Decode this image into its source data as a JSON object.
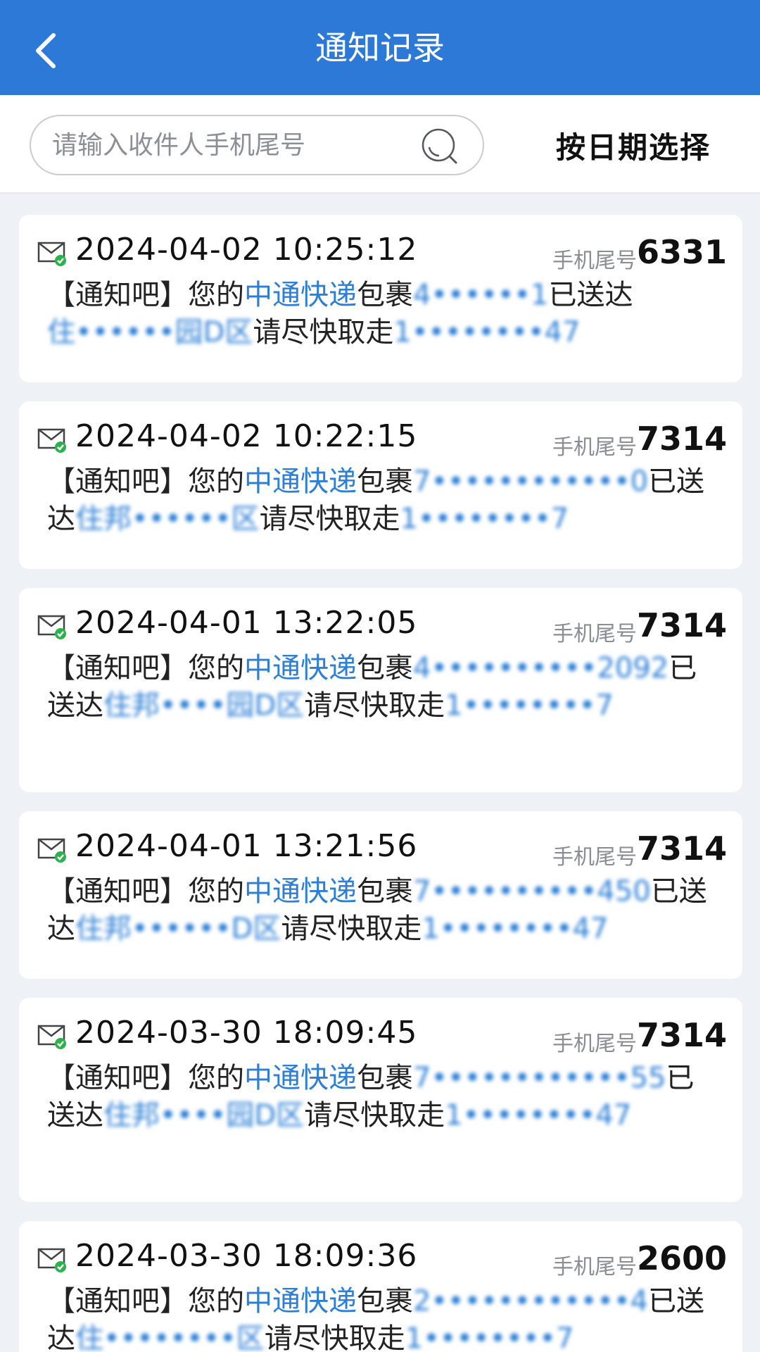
{
  "header": {
    "title": "通知记录",
    "back_icon": "chevron-left-icon"
  },
  "search": {
    "placeholder": "请输入收件人手机尾号",
    "value": "",
    "icon": "search-icon"
  },
  "date_filter": {
    "label": "按日期选择"
  },
  "tail_label": "手机尾号",
  "records": [
    {
      "time": "2024-04-02 10:25:12",
      "tail": "6331",
      "prefix": "【通知吧】您的",
      "courier": "中通快递",
      "pkg_word": "包裹",
      "tracking": "4••••••1",
      "delivered": "已送达",
      "location": "住••••••园D区",
      "pickup": "请尽快取走",
      "phone": "1••••••••47"
    },
    {
      "time": "2024-04-02 10:22:15",
      "tail": "7314",
      "prefix": "【通知吧】您的",
      "courier": "中通快递",
      "pkg_word": "包裹",
      "tracking": "7••••••••••••0",
      "delivered": "已送达",
      "location": "住邦••••••区",
      "pickup": "请尽快取走",
      "phone": "1••••••••7"
    },
    {
      "time": "2024-04-01 13:22:05",
      "tail": "7314",
      "prefix": "【通知吧】您的",
      "courier": "中通快递",
      "pkg_word": "包裹",
      "tracking": "4••••••••••2092",
      "delivered": "已送达",
      "location": "住邦••••园D区",
      "pickup": "请尽快取走",
      "phone": "1••••••••7"
    },
    {
      "time": "2024-04-01 13:21:56",
      "tail": "7314",
      "prefix": "【通知吧】您的",
      "courier": "中通快递",
      "pkg_word": "包裹",
      "tracking": "7••••••••••450",
      "delivered": "已送达",
      "location": "住邦••••••D区",
      "pickup": "请尽快取走",
      "phone": "1••••••••47"
    },
    {
      "time": "2024-03-30 18:09:45",
      "tail": "7314",
      "prefix": "【通知吧】您的",
      "courier": "中通快递",
      "pkg_word": "包裹",
      "tracking": "7••••••••••••55",
      "delivered": "已送达",
      "location": "住邦••••园D区",
      "pickup": "请尽快取走",
      "phone": "1••••••••47"
    },
    {
      "time": "2024-03-30 18:09:36",
      "tail": "2600",
      "prefix": "【通知吧】您的",
      "courier": "中通快递",
      "pkg_word": "包裹",
      "tracking": "2••••••••••••4",
      "delivered": "已送达",
      "location": "住••••••••区",
      "pickup": "请尽快取走",
      "phone": "1••••••••7"
    }
  ],
  "colors": {
    "header_bg": "#2c79d8",
    "link_blue": "#2b7fd6",
    "page_bg": "#eef1f5"
  }
}
